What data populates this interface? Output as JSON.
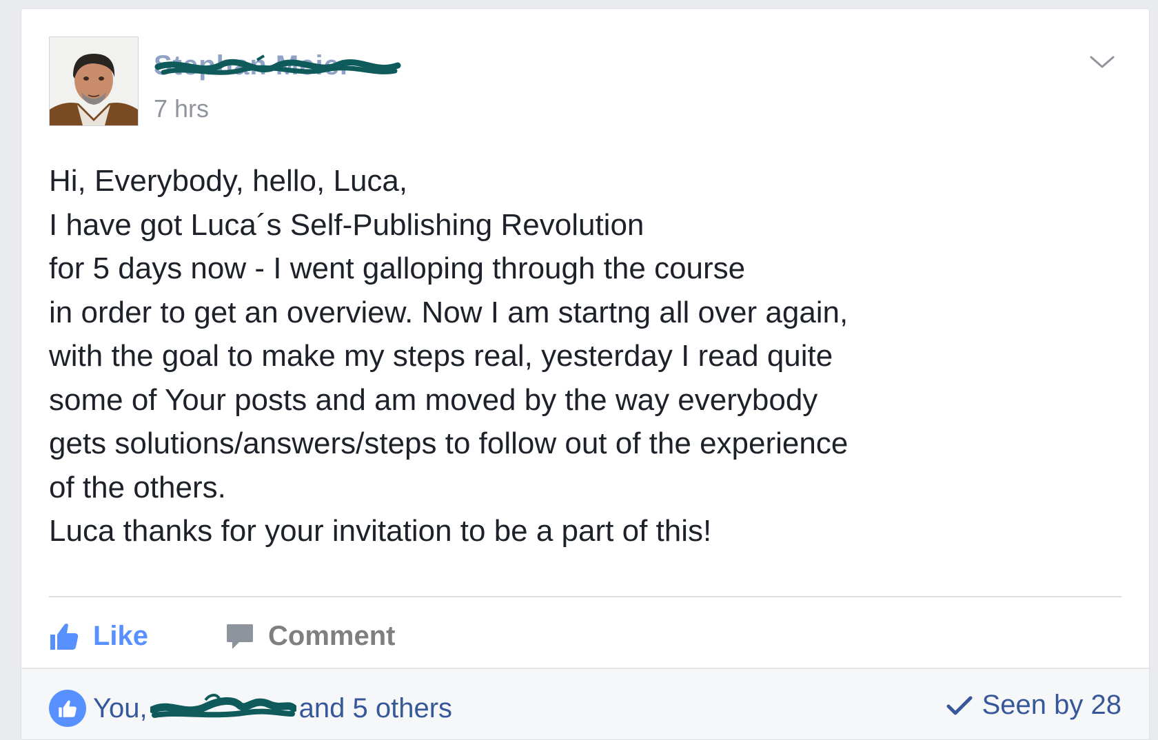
{
  "post": {
    "author_name": "Stephan Meier",
    "timestamp": "7 hrs",
    "menu_icon": "chevron-down-icon",
    "body_lines": [
      "Hi, Everybody, hello, Luca,",
      "I have got Luca´s Self-Publishing Revolution",
      "for 5 days now - I went galloping through the course",
      "in order to get an overview. Now I am startng all over again,",
      "with the goal to make my steps real, yesterday I read quite",
      "some of Your posts and am moved by the way everybody",
      "gets solutions/answers/steps to follow out of the experience",
      "of the others.",
      "Luca thanks for your invitation to be a part of this!"
    ]
  },
  "actions": {
    "like_label": "Like",
    "like_icon": "thumbs-up-icon",
    "comment_label": "Comment",
    "comment_icon": "comment-bubble-icon"
  },
  "footer": {
    "reactions_prefix": "You,",
    "reactions_suffix": "and 5 others",
    "seen_label": "Seen by 28",
    "seen_icon": "checkmark-icon"
  },
  "colors": {
    "link_blue": "#365899",
    "like_blue": "#5890ff",
    "text": "#1d2129",
    "meta_gray": "#90949c",
    "redaction_ink": "#0f5b5b"
  }
}
